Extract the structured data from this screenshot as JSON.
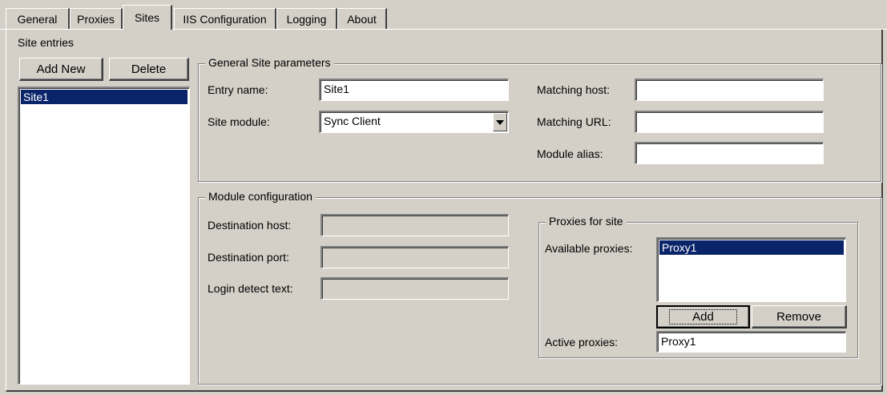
{
  "tabs": [
    {
      "label": "General"
    },
    {
      "label": "Proxies"
    },
    {
      "label": "Sites"
    },
    {
      "label": "IIS Configuration"
    },
    {
      "label": "Logging"
    },
    {
      "label": "About"
    }
  ],
  "site_entries": {
    "title": "Site entries",
    "add_new_label": "Add New",
    "delete_label": "Delete",
    "items": [
      "Site1"
    ]
  },
  "general_params": {
    "title": "General Site parameters",
    "entry_name_label": "Entry name:",
    "entry_name_value": "Site1",
    "site_module_label": "Site module:",
    "site_module_value": "Sync Client",
    "matching_host_label": "Matching host:",
    "matching_host_value": "",
    "matching_url_label": "Matching URL:",
    "matching_url_value": "",
    "module_alias_label": "Module alias:",
    "module_alias_value": ""
  },
  "module_config": {
    "title": "Module configuration",
    "dest_host_label": "Destination host:",
    "dest_port_label": "Destination port:",
    "login_detect_label": "Login detect text:"
  },
  "proxies_for_site": {
    "title": "Proxies for site",
    "available_label": "Available proxies:",
    "available_items": [
      "Proxy1"
    ],
    "add_label": "Add",
    "remove_label": "Remove",
    "active_label": "Active proxies:",
    "active_value": "Proxy1"
  }
}
